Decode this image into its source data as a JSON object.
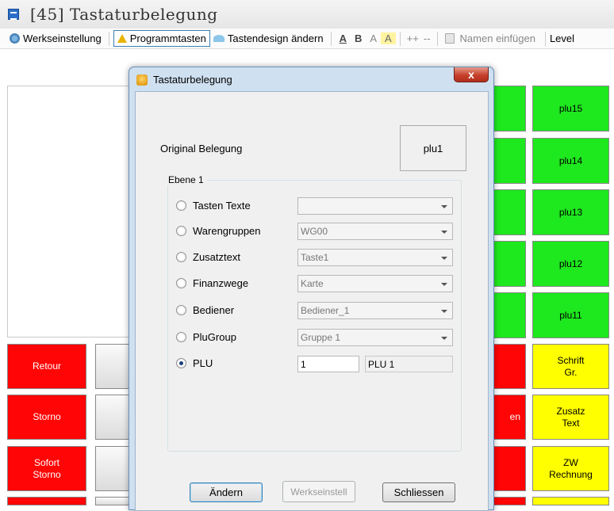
{
  "window": {
    "title": "[45] Tastaturbelegung"
  },
  "toolbar": {
    "werkseinstellung": "Werkseinstellung",
    "programmtasten": "Programmtasten",
    "tastendesign": "Tastendesign ändern",
    "fmt_a1": "A",
    "fmt_b": "B",
    "fmt_a2": "A",
    "fmt_a3": "A",
    "plusplus": "++",
    "minusminus": "--",
    "namen_einfuegen": "Namen einfügen",
    "level": "Level"
  },
  "keys": {
    "plu15": "plu15",
    "plu14": "plu14",
    "plu13": "plu13",
    "plu12": "plu12",
    "plu11": "plu11",
    "retour": "Retour",
    "storno": "Storno",
    "sofort_storno_1": "Sofort",
    "sofort_storno_2": "Storno",
    "schrift_1": "Schrift",
    "schrift_2": "Gr.",
    "zusatz_1": "Zusatz",
    "zusatz_2": "Text",
    "zw_1": "ZW",
    "zw_2": "Rechnung",
    "partial_en": "en"
  },
  "colors": {
    "green": "#1ee81e",
    "red": "#ff0505",
    "yellow": "#ffff00"
  },
  "dialog": {
    "title": "Tastaturbelegung",
    "close": "x",
    "original_label": "Original Belegung",
    "original_value": "plu1",
    "group_title": "Ebene 1",
    "options": [
      {
        "label": "Tasten Texte",
        "value": "",
        "selected": false
      },
      {
        "label": "Warengruppen",
        "value": "WG00",
        "selected": false
      },
      {
        "label": "Zusatztext",
        "value": "Taste1",
        "selected": false
      },
      {
        "label": "Finanzwege",
        "value": "Karte",
        "selected": false
      },
      {
        "label": "Bediener",
        "value": "Bediener_1",
        "selected": false
      },
      {
        "label": "PluGroup",
        "value": "Gruppe 1",
        "selected": false
      },
      {
        "label": "PLU",
        "value": "1",
        "selected": true
      }
    ],
    "plu_name": "PLU 1",
    "buttons": {
      "aendern": "Ändern",
      "werkseinstell": "Werkseinstell",
      "schliessen": "Schliessen"
    }
  }
}
